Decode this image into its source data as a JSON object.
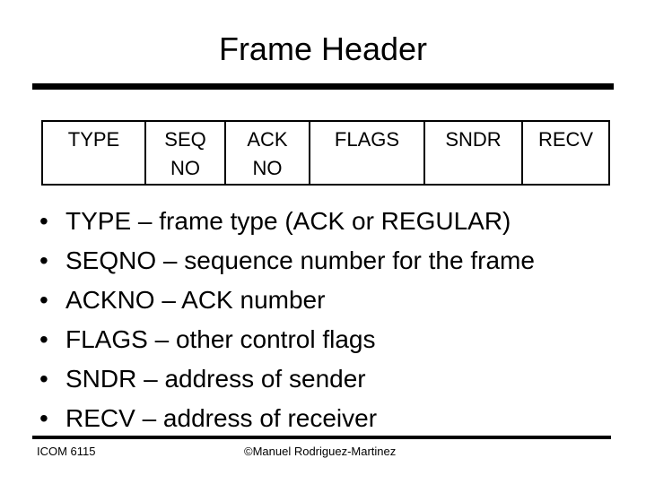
{
  "slide": {
    "title": "Frame Header",
    "frame_fields": [
      {
        "line1": "TYPE",
        "line2": ""
      },
      {
        "line1": "SEQ",
        "line2": "NO"
      },
      {
        "line1": "ACK",
        "line2": "NO"
      },
      {
        "line1": "FLAGS",
        "line2": ""
      },
      {
        "line1": "SNDR",
        "line2": ""
      },
      {
        "line1": "RECV",
        "line2": ""
      }
    ],
    "bullet_glyph": "•",
    "bullets": [
      "TYPE – frame type (ACK or REGULAR)",
      "SEQNO – sequence number for the frame",
      "ACKNO – ACK number",
      "FLAGS – other control flags",
      "SNDR – address of sender",
      "RECV – address of receiver"
    ]
  },
  "footer": {
    "course": "ICOM 6115",
    "copyright": "©Manuel Rodriguez-Martinez"
  }
}
